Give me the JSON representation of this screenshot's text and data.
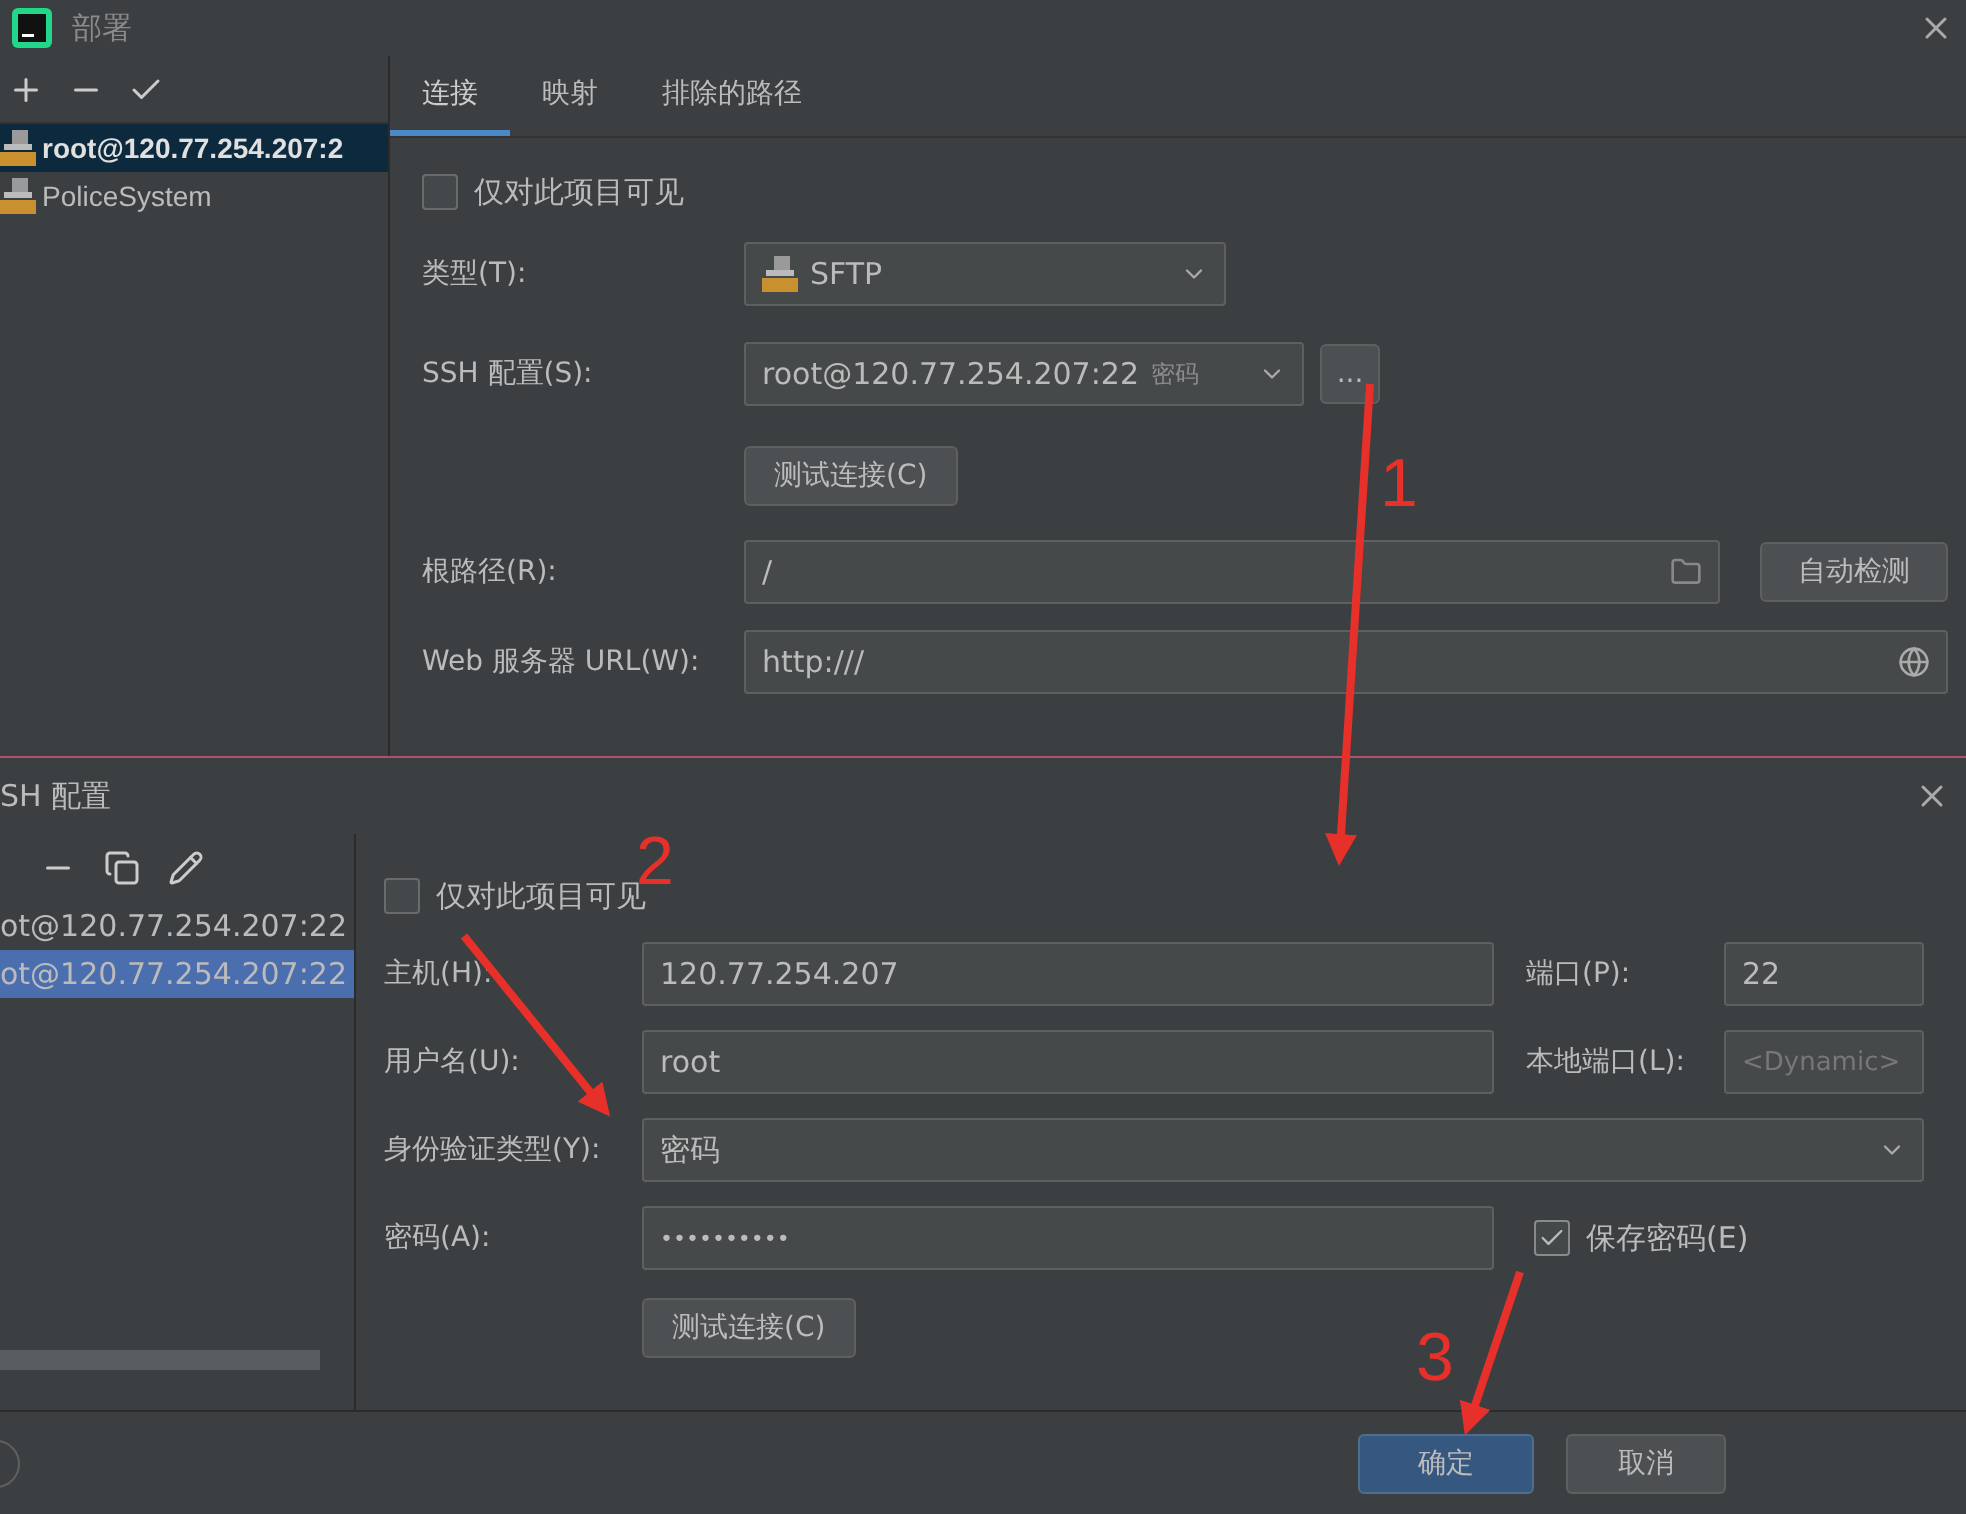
{
  "deployment_dialog": {
    "title": "部署",
    "servers": [
      {
        "name": "root@120.77.254.207:2",
        "selected": true
      },
      {
        "name": "PoliceSystem",
        "selected": false
      }
    ],
    "tabs": [
      {
        "label": "连接",
        "selected": true
      },
      {
        "label": "映射",
        "selected": false
      },
      {
        "label": "排除的路径",
        "selected": false
      }
    ],
    "visible_only_here": {
      "label": "仅对此项目可见",
      "checked": false
    },
    "type": {
      "label": "类型(T):",
      "value": "SFTP"
    },
    "ssh_config": {
      "label": "SSH 配置(S):",
      "value": "root@120.77.254.207:22",
      "hint": "密码"
    },
    "browse_button": "...",
    "test_button": "测试连接(C)",
    "root_path": {
      "label": "根路径(R):",
      "value": "/"
    },
    "autodetect_button": "自动检测",
    "web_url": {
      "label": "Web 服务器 URL(W):",
      "value": "http:///"
    }
  },
  "ssh_dialog": {
    "title": "SH 配置",
    "configs": [
      {
        "name": "ot@120.77.254.207:22",
        "selected": false
      },
      {
        "name": "ot@120.77.254.207:22",
        "selected": true
      }
    ],
    "visible_only_here": {
      "label": "仅对此项目可见",
      "checked": false
    },
    "host": {
      "label": "主机(H):",
      "value": "120.77.254.207"
    },
    "port": {
      "label": "端口(P):",
      "value": "22"
    },
    "username": {
      "label": "用户名(U):",
      "value": "root"
    },
    "local_port": {
      "label": "本地端口(L):",
      "placeholder": "<Dynamic>"
    },
    "auth_type": {
      "label": "身份验证类型(Y):",
      "value": "密码"
    },
    "password": {
      "label": "密码(A):",
      "value": "••••••••••"
    },
    "save_password": {
      "label": "保存密码(E)",
      "checked": true
    },
    "test_button": "测试连接(C)",
    "ok_button": "确定",
    "cancel_button": "取消"
  },
  "annotations": [
    {
      "label": "1"
    },
    {
      "label": "2"
    },
    {
      "label": "3"
    }
  ]
}
